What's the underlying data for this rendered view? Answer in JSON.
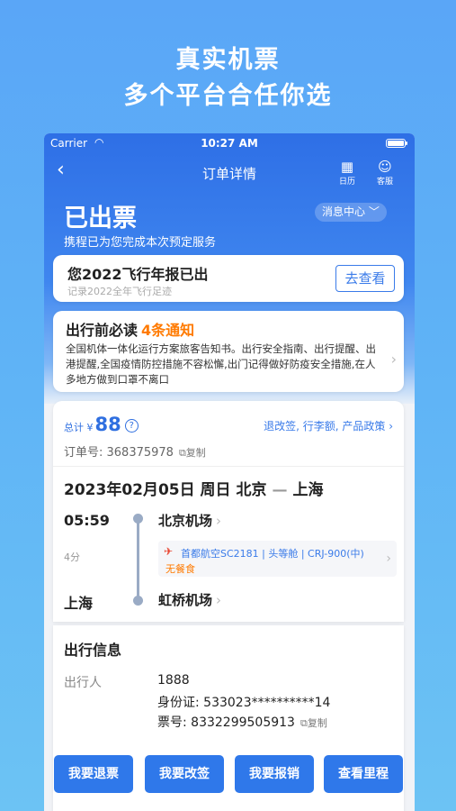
{
  "promo": {
    "line1": "真实机票",
    "line2": "多个平台合任你选"
  },
  "status_bar": {
    "carrier": "Carrier",
    "time": "10:27 AM"
  },
  "nav": {
    "title": "订单详情",
    "calendar_label": "日历",
    "service_label": "客服"
  },
  "order_status": {
    "title": "已出票",
    "subtitle": "携程已为您完成本次预定服务",
    "message_center": "消息中心 ﹀"
  },
  "annual_report": {
    "title": "您2022飞行年报已出",
    "subtitle": "记录2022全年飞行足迹",
    "button": "去查看"
  },
  "notice": {
    "title": "出行前必读",
    "count": "4条通知",
    "body": "全国机体一体化运行方案旅客告知书。出行安全指南、出行提醒、出港提醒,全国疫情防控措施不容松懈,出门记得做好防疫安全措施,在人多地方做到口罩不离口"
  },
  "order": {
    "total_label": "总计 ¥",
    "total_amount": "88",
    "policy_links": "退改签, 行李额, 产品政策 ›",
    "order_no": "订单号: 368375978",
    "copy_label": "⧉复制"
  },
  "flight": {
    "date_route_prefix": "2023年02月05日 周日 北京",
    "dash": "—",
    "destination": "上海",
    "dep_time": "05:59",
    "duration": "4分",
    "arr_city": "上海",
    "dep_airport": "北京机场",
    "arr_airport": "虹桥机场",
    "info": "首都航空SC2181 | 头等舱 | CRJ-900(中)",
    "meal": "无餐食"
  },
  "travel_info": {
    "heading": "出行信息",
    "passenger_label": "出行人",
    "passenger_name": "1888",
    "id_line": "身份证: 533023**********14",
    "ticket_line": "票号: 8332299505913",
    "copy_label": "⧉复制"
  },
  "actions": {
    "refund": "我要退票",
    "change": "我要改签",
    "reimburse": "我要报销",
    "itinerary": "查看里程"
  }
}
